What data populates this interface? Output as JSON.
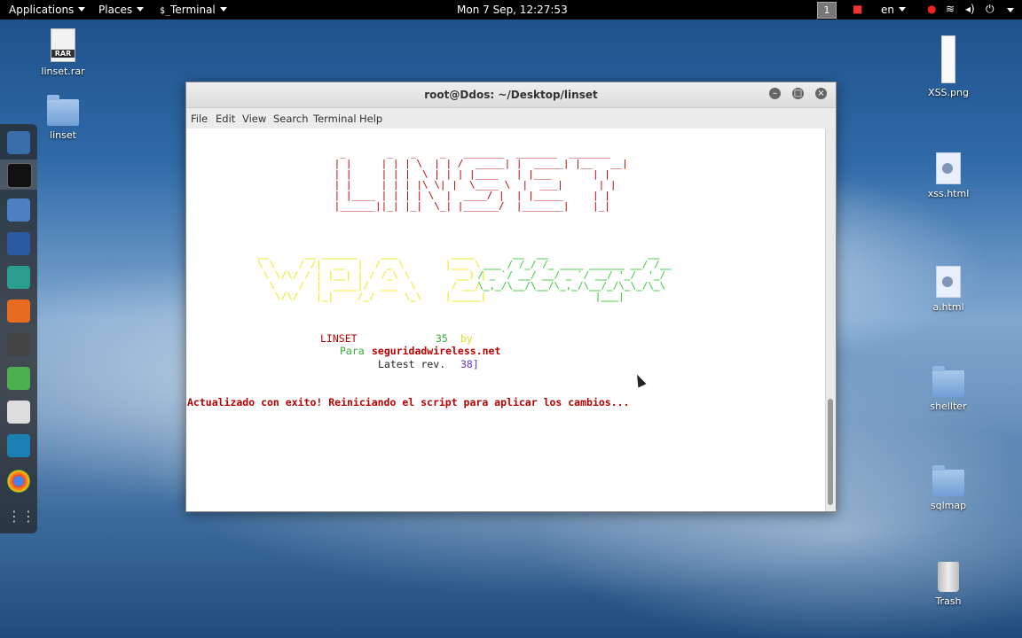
{
  "topbar": {
    "applications": "Applications",
    "places": "Places",
    "terminal": "Terminal",
    "clock": "Mon  7 Sep, 12:27:53",
    "workspace": "1",
    "language": "en"
  },
  "desktop": {
    "left_icons": [
      {
        "label": "linset.rar",
        "icon": "rar-archive-icon"
      },
      {
        "label": "linset",
        "icon": "folder-icon"
      }
    ],
    "right_icons": [
      {
        "label": "XSS.png",
        "icon": "image-file-icon"
      },
      {
        "label": "xss.html",
        "icon": "html-file-icon"
      },
      {
        "label": "a.html",
        "icon": "html-file-icon"
      },
      {
        "label": "shellter",
        "icon": "folder-icon"
      },
      {
        "label": "sqlmap",
        "icon": "folder-icon"
      },
      {
        "label": "Trash",
        "icon": "trash-icon"
      }
    ]
  },
  "dock": {
    "apps": [
      "iceweasel-icon",
      "terminal-icon",
      "files-icon",
      "metasploit-icon",
      "armitage-icon",
      "burpsuite-icon",
      "cherrytree-icon",
      "leafpad-icon",
      "gui-icon",
      "recordmydesktop-icon",
      "chrome-icon",
      "show-apps-icon"
    ]
  },
  "window": {
    "title": "root@Ddos: ~/Desktop/linset",
    "menu": [
      "File",
      "Edit",
      "View",
      "Search",
      "Terminal",
      "Help"
    ]
  },
  "terminal": {
    "linset_label": "LINSET",
    "version_num": "35",
    "by": "by",
    "para": "Para",
    "site": "seguridadwireless.net",
    "latest_rev": "Latest rev.",
    "rev_num": "38]",
    "status_message": "Actualizado con exito! Reiniciando el script para aplicar los cambios..."
  },
  "colors": {
    "red": "#bb0000",
    "green": "#33aa33",
    "yellow": "#dddd22",
    "purple": "#6633cc"
  }
}
